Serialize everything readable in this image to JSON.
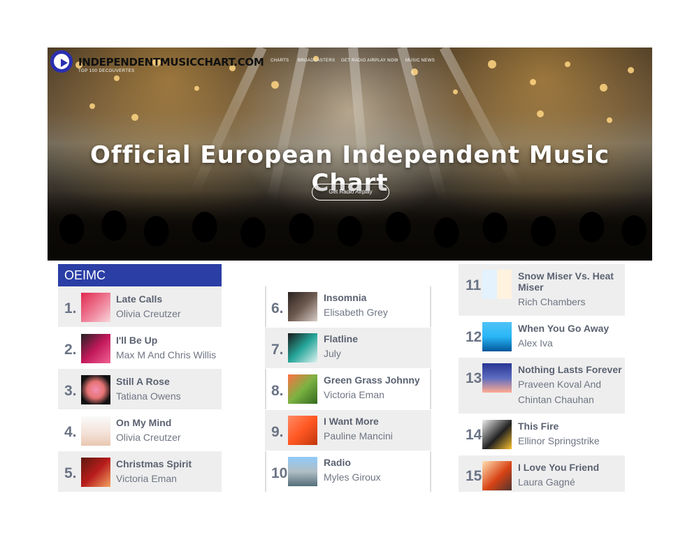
{
  "site": {
    "logo_text": "INDEPENDENTMUSICCHART.COM",
    "logo_sub": "TOP 100 DECOUVERTES",
    "nav": [
      "CHARTS",
      "BROADCASTERS",
      "GET RADIO AIRPLAY NOW",
      "MUSIC NEWS"
    ]
  },
  "hero": {
    "title": "Official European Independent Music Chart",
    "button": "Get Radio Airplay"
  },
  "chart": {
    "header": "OEIMC",
    "col1": [
      {
        "rank": "1.",
        "title": "Late Calls",
        "artist": "Olivia Creutzer"
      },
      {
        "rank": "2.",
        "title": "I'll Be Up",
        "artist": "Max M And Chris Willis"
      },
      {
        "rank": "3.",
        "title": "Still A Rose",
        "artist": "Tatiana Owens"
      },
      {
        "rank": "4.",
        "title": "On My Mind",
        "artist": "Olivia Creutzer"
      },
      {
        "rank": "5.",
        "title": "Christmas Spirit",
        "artist": "Victoria Eman"
      }
    ],
    "col2": [
      {
        "rank": "6.",
        "title": "Insomnia",
        "artist": "Elisabeth Grey"
      },
      {
        "rank": "7.",
        "title": "Flatline",
        "artist": "July"
      },
      {
        "rank": "8.",
        "title": "Green Grass Johnny",
        "artist": "Victoria Eman"
      },
      {
        "rank": "9.",
        "title": "I Want More",
        "artist": "Pauline Mancini"
      },
      {
        "rank": "10",
        "title": "Radio",
        "artist": "Myles Giroux"
      }
    ],
    "col3": [
      {
        "rank": "11",
        "title": "Snow Miser Vs. Heat Miser",
        "artist": "Rich Chambers"
      },
      {
        "rank": "12",
        "title": "When You Go Away",
        "artist": "Alex Iva"
      },
      {
        "rank": "13",
        "title": "Nothing Lasts Forever",
        "artist": "Praveen Koval And Chintan Chauhan"
      },
      {
        "rank": "14",
        "title": "This Fire",
        "artist": "Ellinor Springstrike"
      },
      {
        "rank": "15",
        "title": "I Love You Friend",
        "artist": "Laura Gagné"
      }
    ]
  },
  "colors": {
    "brand": "#2b3ea5",
    "row_grey": "#eeeeee",
    "text_rank": "#6b7485"
  }
}
